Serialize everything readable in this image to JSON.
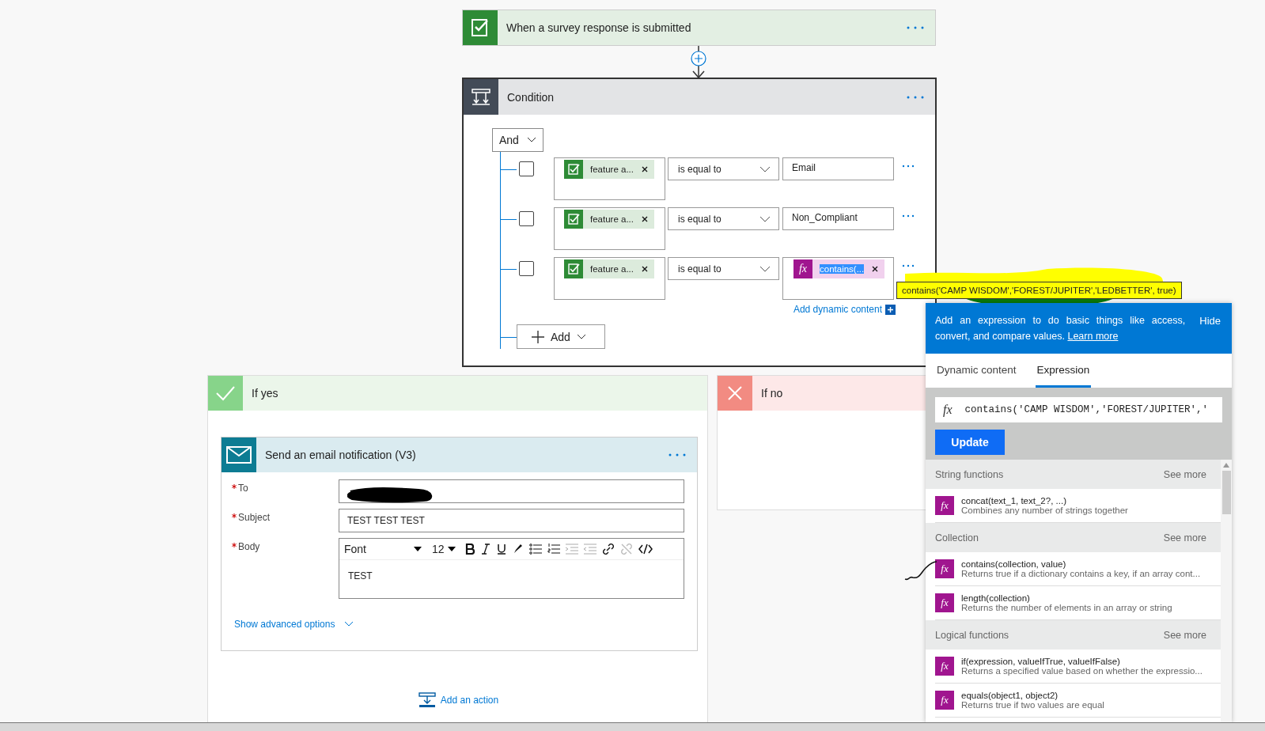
{
  "trigger": {
    "title": "When a survey response is submitted"
  },
  "condition": {
    "title": "Condition",
    "operator": "And",
    "rows": [
      {
        "checked": false,
        "left": "feature a...",
        "op": "is equal to",
        "kind": "text",
        "value": "Email"
      },
      {
        "checked": false,
        "left": "feature a...",
        "op": "is equal to",
        "kind": "text",
        "value": "Non_Compliant"
      },
      {
        "checked": false,
        "left": "feature a...",
        "op": "is equal to",
        "kind": "expression",
        "icon": "fx",
        "value": "contains(..."
      }
    ],
    "add_dynamic": "Add dynamic content",
    "add": "Add"
  },
  "tooltip": "contains('CAMP WISDOM','FOREST/JUPITER','LEDBETTER', true)",
  "if_yes": {
    "title": "If yes",
    "action": {
      "title": "Send an email notification (V3)",
      "fields": [
        {
          "label": "To",
          "required": true,
          "kind": "redacted"
        },
        {
          "label": "Subject",
          "required": true,
          "kind": "text",
          "value": "TEST TEST TEST"
        },
        {
          "label": "Body",
          "required": true,
          "kind": "rich",
          "font": "Font",
          "size": "12",
          "value": "TEST"
        }
      ],
      "advanced": "Show advanced options"
    },
    "add_action": "Add an action"
  },
  "if_no": {
    "title": "If no"
  },
  "panel": {
    "info": "Add an expression to do basic things like access, convert, and compare values.",
    "learn_more": "Learn more",
    "hide": "Hide",
    "tabs": [
      {
        "label": "Dynamic content",
        "selected": false
      },
      {
        "label": "Expression",
        "selected": true
      }
    ],
    "expression_icon": "fx",
    "expression": "contains('CAMP WISDOM','FOREST/JUPITER','",
    "update": "Update",
    "groups": [
      {
        "title": "String functions",
        "see_more": "See more",
        "functions": [
          {
            "icon": "fx",
            "name": "concat(text_1, text_2?, ...)",
            "desc": "Combines any number of strings together"
          }
        ]
      },
      {
        "title": "Collection",
        "see_more": "See more",
        "functions": [
          {
            "icon": "fx",
            "name": "contains(collection, value)",
            "desc": "Returns true if a dictionary contains a key, if an array cont..."
          },
          {
            "icon": "fx",
            "name": "length(collection)",
            "desc": "Returns the number of elements in an array or string"
          }
        ]
      },
      {
        "title": "Logical functions",
        "see_more": "See more",
        "functions": [
          {
            "icon": "fx",
            "name": "if(expression, valueIfTrue, valueIfFalse)",
            "desc": "Returns a specified value based on whether the expressio..."
          },
          {
            "icon": "fx",
            "name": "equals(object1, object2)",
            "desc": "Returns true if two values are equal"
          }
        ]
      }
    ]
  }
}
